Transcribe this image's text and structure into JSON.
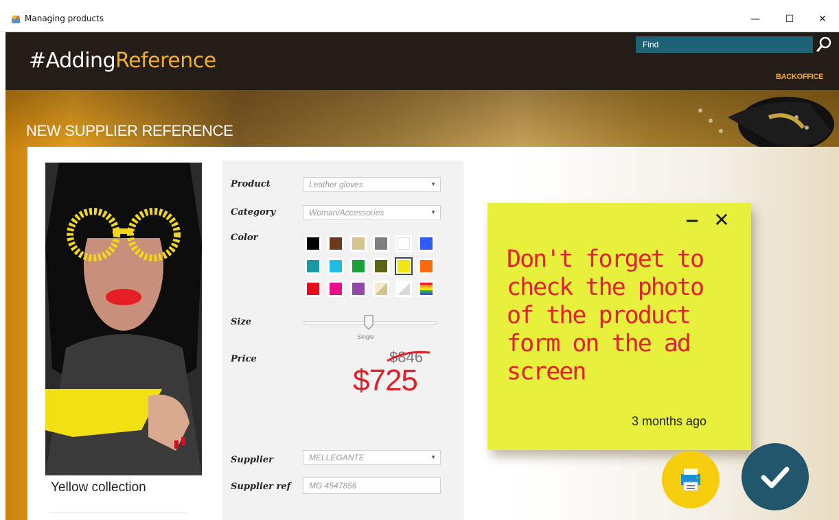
{
  "window": {
    "title": "Managing products",
    "controls": {
      "minimize": "—",
      "maximize": "☐",
      "close": "✕"
    }
  },
  "header": {
    "brand_prefix": "#Adding",
    "brand_accent": "Reference",
    "search_placeholder": "Find",
    "nav_link": "BACKOFFICE"
  },
  "page": {
    "title": "NEW SUPPLIER REFERENCE"
  },
  "product": {
    "caption": "Yellow collection"
  },
  "form": {
    "product_label": "Product",
    "product_value": "Leather gloves",
    "category_label": "Category",
    "category_value": "Woman/Accessories",
    "color_label": "Color",
    "colors": [
      "#000000",
      "#6b3a1c",
      "#d7c38f",
      "#7f7f7f",
      "#ffffff",
      "#2d5bff",
      "#1a9aa0",
      "#21bde0",
      "#17a23a",
      "#5a6612",
      "#f2e60f",
      "#ff6a0a",
      "#e80c18",
      "#e8108a",
      "#8f4aa8",
      "pattern-beige",
      "pattern-white",
      "pattern-rainbow"
    ],
    "selected_color_index": 10,
    "size_label": "Size",
    "size_value": "Single",
    "price_label": "Price",
    "old_price": "$846",
    "new_price": "$725",
    "supplier_label": "Supplier",
    "supplier_value": "MELLEGANTE",
    "supplier_ref_label": "Supplier ref",
    "supplier_ref_value": "MG 4547856"
  },
  "sticky_note": {
    "text": "Don't forget to check the photo of the product form on the ad screen",
    "time": "3 months ago",
    "minimize": "−",
    "close": "✕",
    "color": "#e7f03a"
  },
  "actions": {
    "print_color": "#f6cd0d",
    "confirm_color": "#22566c"
  },
  "theme": {
    "accent": "#f1ad2c",
    "header_bg": "#241c17",
    "price_red": "#e21f26"
  }
}
